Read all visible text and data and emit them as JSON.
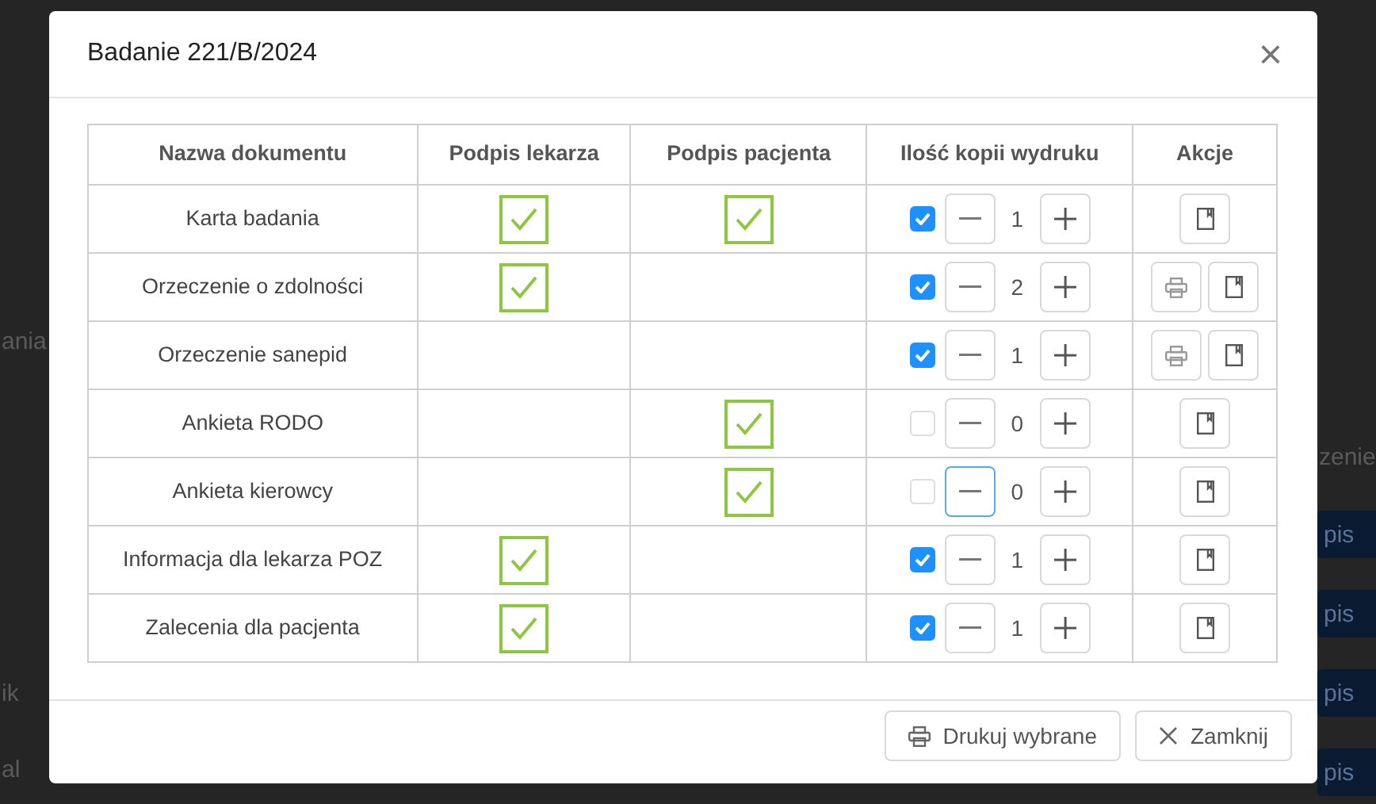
{
  "background": {
    "texts": [
      "ania",
      "ik",
      "al",
      "zenie"
    ],
    "buttons": [
      "pis",
      "pis",
      "pis",
      "pis"
    ]
  },
  "dialog": {
    "title": "Badanie 221/B/2024",
    "close": "×"
  },
  "table": {
    "columns": [
      "Nazwa dokumentu",
      "Podpis lekarza",
      "Podpis pacjenta",
      "Ilość kopii wydruku",
      "Akcje"
    ],
    "rows": [
      {
        "name": "Karta badania",
        "doctor_signed": true,
        "patient_signed": true,
        "print_selected": true,
        "copies": "1",
        "minus_focused": false,
        "actions": [
          {
            "kind": "document"
          }
        ]
      },
      {
        "name": "Orzeczenie o zdolności",
        "doctor_signed": true,
        "patient_signed": false,
        "print_selected": true,
        "copies": "2",
        "minus_focused": false,
        "actions": [
          {
            "kind": "print"
          },
          {
            "kind": "document"
          }
        ]
      },
      {
        "name": "Orzeczenie sanepid",
        "doctor_signed": false,
        "patient_signed": false,
        "print_selected": true,
        "copies": "1",
        "minus_focused": false,
        "actions": [
          {
            "kind": "print"
          },
          {
            "kind": "document"
          }
        ]
      },
      {
        "name": "Ankieta RODO",
        "doctor_signed": false,
        "patient_signed": true,
        "print_selected": false,
        "copies": "0",
        "minus_focused": false,
        "actions": [
          {
            "kind": "document"
          }
        ]
      },
      {
        "name": "Ankieta kierowcy",
        "doctor_signed": false,
        "patient_signed": true,
        "print_selected": false,
        "copies": "0",
        "minus_focused": true,
        "actions": [
          {
            "kind": "document"
          }
        ]
      },
      {
        "name": "Informacja dla lekarza POZ",
        "doctor_signed": true,
        "patient_signed": false,
        "print_selected": true,
        "copies": "1",
        "minus_focused": false,
        "actions": [
          {
            "kind": "document"
          }
        ]
      },
      {
        "name": "Zalecenia dla pacjenta",
        "doctor_signed": true,
        "patient_signed": false,
        "print_selected": true,
        "copies": "1",
        "minus_focused": false,
        "actions": [
          {
            "kind": "document"
          }
        ]
      }
    ]
  },
  "footer": {
    "buttons": [
      {
        "kind": "print",
        "label": "Drukuj wybrane"
      },
      {
        "kind": "close",
        "label": "Zamknij"
      }
    ]
  }
}
